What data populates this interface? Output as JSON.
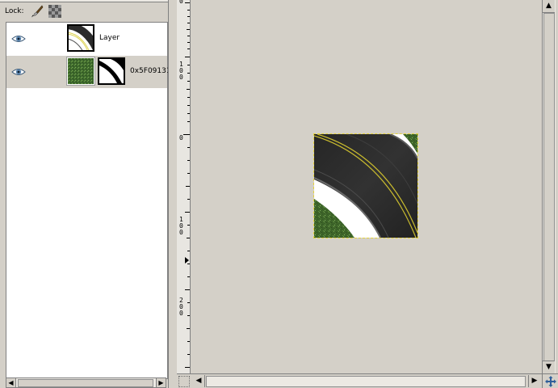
{
  "layers_dock": {
    "lock_label": "Lock:",
    "lock_pixels_icon": "paintbrush-icon",
    "lock_alpha_icon": "checkerboard-icon",
    "layers": [
      {
        "name": "Layer",
        "visible": true,
        "thumbnail": "road-curve",
        "has_mask": false
      },
      {
        "name": "0x5F09131",
        "visible": true,
        "thumbnail": "grass",
        "has_mask": true
      }
    ]
  },
  "canvas": {
    "ruler_labels": [
      "0",
      "1\n0\n0",
      "0",
      "1\n0\n0",
      "2\n0\n0"
    ],
    "background_color": "#d4d0c8",
    "selection_color": "#e5d33b"
  },
  "icons": {
    "eye": "eye-icon",
    "navigate": "navigate-icon",
    "quick_mask": "quick-mask-icon"
  }
}
